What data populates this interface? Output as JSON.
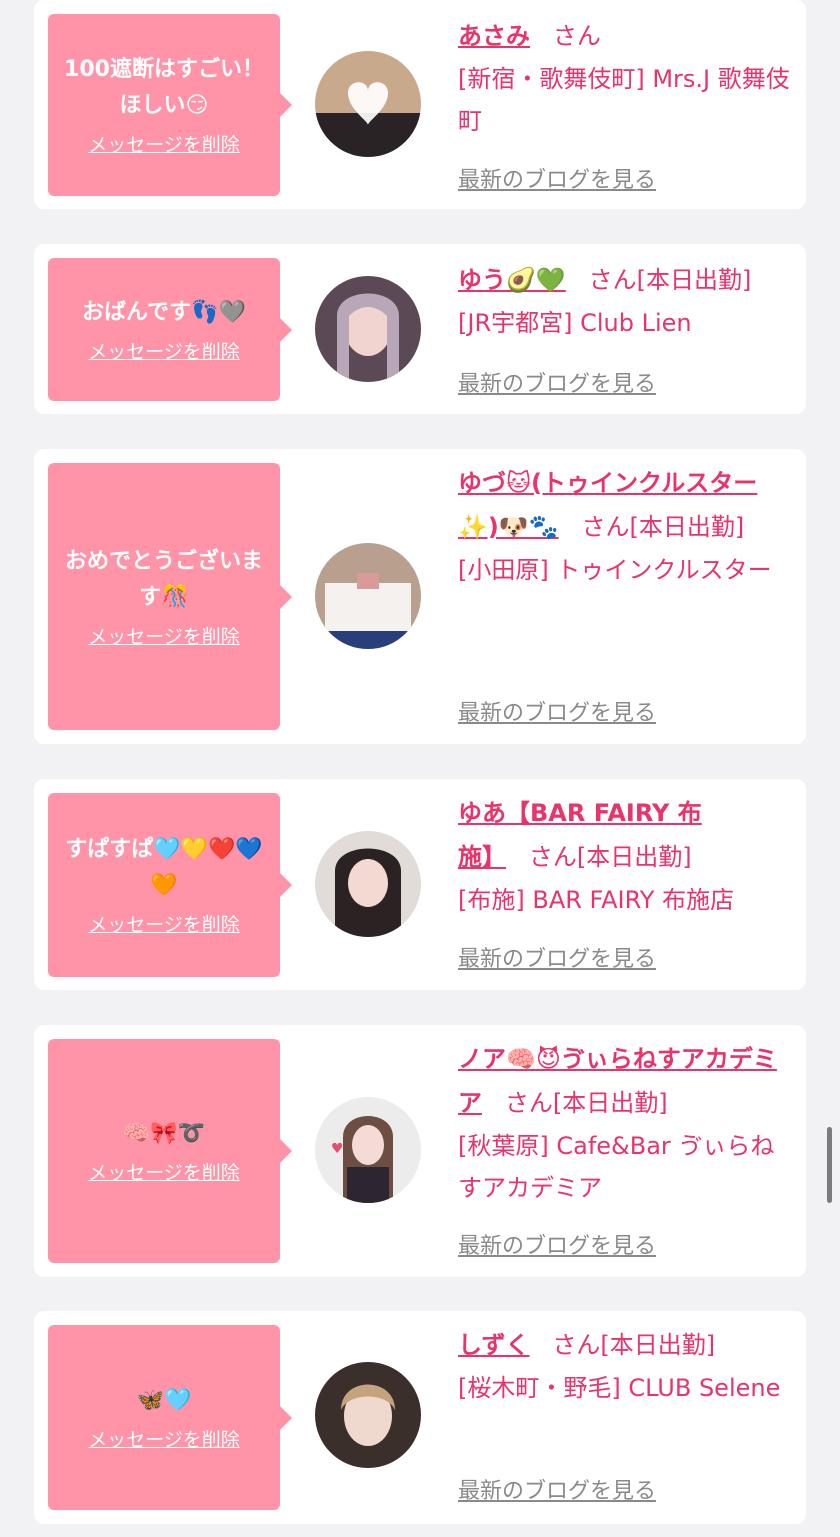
{
  "delete_label": "メッセージを削除",
  "blog_label": "最新のブログを見る",
  "cards": [
    {
      "message": "100遮断はすごい！ほしい😏",
      "name": "あさみ",
      "suffix": "さん",
      "shop": "[新宿・歌舞伎町] Mrs.J 歌舞伎町"
    },
    {
      "message": "おばんです👣🩶",
      "name": "ゆう🥑💚",
      "suffix": "さん[本日出勤]",
      "shop": "[JR宇都宮] Club Lien"
    },
    {
      "message": "おめでとうございます🎊",
      "name": "ゆづ🐱(トゥインクルスター✨)🐶🐾",
      "suffix": "さん[本日出勤]",
      "shop": "[小田原] トゥインクルスター"
    },
    {
      "message": "すぱすぱ🩵💛❤️💙🧡",
      "name": "ゆあ【BAR FAIRY 布施】",
      "suffix": "さん[本日出勤]",
      "shop": "[布施] BAR FAIRY 布施店"
    },
    {
      "message": "🧠🎀➰",
      "name": "ノア🧠😈ゔぃらねすアカデミア",
      "suffix": "さん[本日出勤]",
      "shop": "[秋葉原] Cafe&Bar ゔぃらねすアカデミア"
    },
    {
      "message": "🦋🩵",
      "name": "しずく",
      "suffix": "さん[本日出勤]",
      "shop": "[桜木町・野毛] CLUB Selene"
    }
  ]
}
